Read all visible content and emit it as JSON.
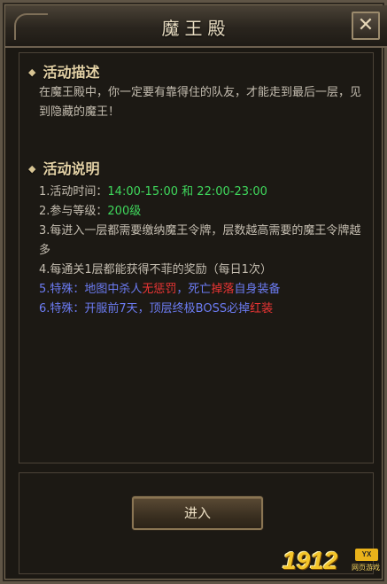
{
  "window": {
    "title": "魔王殿",
    "close_icon": "close-icon",
    "close_label": "✕"
  },
  "description_section": {
    "header": "活动描述",
    "text": "在魔王殿中，你一定要有靠得住的队友，才能走到最后一层，见到隐藏的魔王！"
  },
  "rules_section": {
    "header": "活动说明",
    "rules": [
      {
        "prefix": "1.活动时间：",
        "time1": "14:00-15:00",
        "and": " 和 ",
        "time2": "22:00-23:00"
      },
      {
        "prefix": "2.参与等级：",
        "level": "200级"
      },
      {
        "text": "3.每进入一层都需要缴纳魔王令牌，层数越高需要的魔王令牌越多"
      },
      {
        "text": "4.每通关1层都能获得不菲的奖励（每日1次）"
      },
      {
        "a": "5.特殊：地图中杀人",
        "red1": "无惩罚",
        "b": "，死亡",
        "red2": "掉落",
        "c": "自身装备"
      },
      {
        "a": "6.特殊：开服前7天，顶层终极BOSS必掉",
        "red": "红装"
      }
    ]
  },
  "actions": {
    "enter_label": "进入"
  },
  "watermark": {
    "digits": "1912",
    "badge": "YX",
    "sub": "网页游戏"
  },
  "colors": {
    "green": "#3fd85c",
    "blue": "#6c7cf3",
    "red": "#ee3535",
    "header": "#e4d2a6"
  }
}
